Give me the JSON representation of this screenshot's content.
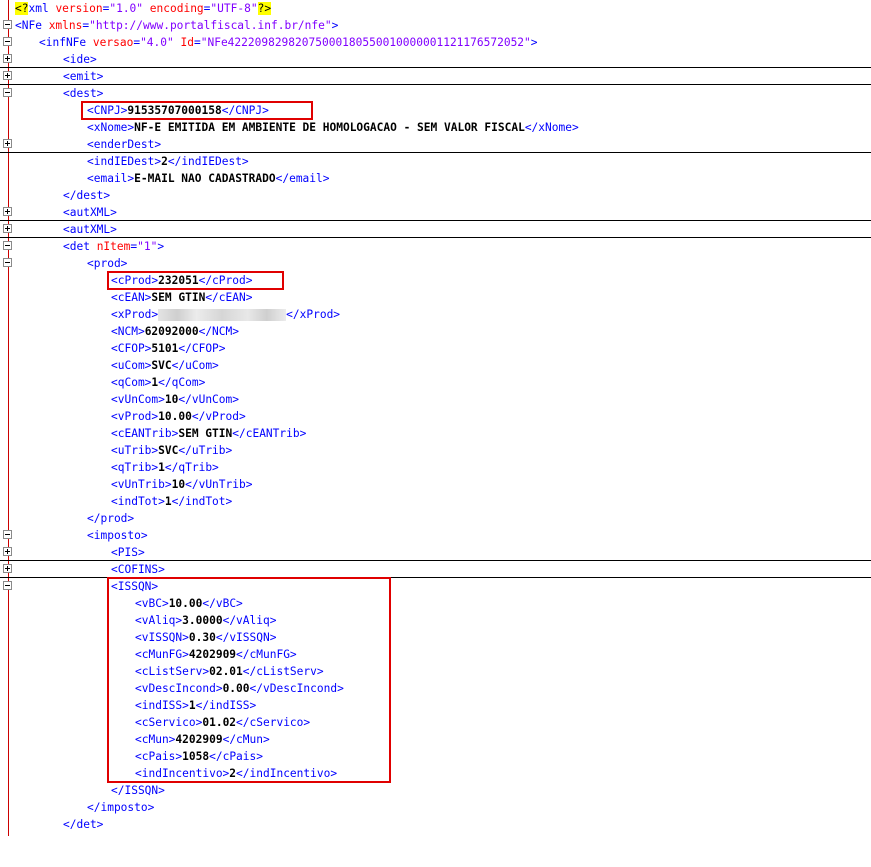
{
  "xml_decl": {
    "open": "<?",
    "name": "xml ",
    "attr1": "version",
    "val1": "\"1.0\"",
    "attr2": "encoding",
    "val2": "\"UTF-8\"",
    "close": "?>"
  },
  "nfe": {
    "tag": "<NFe ",
    "attr": "xmlns",
    "val": "\"http://www.portalfiscal.inf.br/nfe\"",
    "close": ">"
  },
  "infnfe": {
    "tag": "<infNFe ",
    "attr1": "versao",
    "val1": "\"4.0\"",
    "attr2": "Id",
    "val2": "\"NFe42220982982075000180550010000001121176572052\"",
    "close": ">"
  },
  "ide": "<ide>",
  "emit": "<emit>",
  "dest_open": "<dest>",
  "dest": {
    "cnpj_open": "<CNPJ>",
    "cnpj": "91535707000158",
    "cnpj_close": "</CNPJ>",
    "xnome_open": "<xNome>",
    "xnome": "NF-E EMITIDA EM AMBIENTE DE HOMOLOGACAO - SEM VALOR FISCAL",
    "xnome_close": "</xNome>",
    "ender": "<enderDest>",
    "indie_open": "<indIEDest>",
    "indie": "2",
    "indie_close": "</indIEDest>",
    "email_open": "<email>",
    "email": "E-MAIL NAO CADASTRADO",
    "email_close": "</email>"
  },
  "dest_close": "</dest>",
  "autxml1": "<autXML>",
  "autxml2": "<autXML>",
  "det": {
    "tag": "<det ",
    "attr": "nItem",
    "val": "\"1\"",
    "close": ">"
  },
  "prod_open": "<prod>",
  "prod": {
    "cprod_open": "<cProd>",
    "cprod": "232051",
    "cprod_close": "</cProd>",
    "cean_open": "<cEAN>",
    "cean": "SEM GTIN",
    "cean_close": "</cEAN>",
    "xprod_open": "<xProd>",
    "xprod_close": "</xProd>",
    "ncm_open": "<NCM>",
    "ncm": "62092000",
    "ncm_close": "</NCM>",
    "cfop_open": "<CFOP>",
    "cfop": "5101",
    "cfop_close": "</CFOP>",
    "ucom_open": "<uCom>",
    "ucom": "SVC",
    "ucom_close": "</uCom>",
    "qcom_open": "<qCom>",
    "qcom": "1",
    "qcom_close": "</qCom>",
    "vuncom_open": "<vUnCom>",
    "vuncom": "10",
    "vuncom_close": "</vUnCom>",
    "vprod_open": "<vProd>",
    "vprod": "10.00",
    "vprod_close": "</vProd>",
    "ceantrib_open": "<cEANTrib>",
    "ceantrib": "SEM GTIN",
    "ceantrib_close": "</cEANTrib>",
    "utrib_open": "<uTrib>",
    "utrib": "SVC",
    "utrib_close": "</uTrib>",
    "qtrib_open": "<qTrib>",
    "qtrib": "1",
    "qtrib_close": "</qTrib>",
    "vuntrib_open": "<vUnTrib>",
    "vuntrib": "10",
    "vuntrib_close": "</vUnTrib>",
    "indtot_open": "<indTot>",
    "indtot": "1",
    "indtot_close": "</indTot>"
  },
  "prod_close": "</prod>",
  "imposto_open": "<imposto>",
  "pis": "<PIS>",
  "cofins": "<COFINS>",
  "issqn_open": "<ISSQN>",
  "issqn": {
    "vbc_open": "<vBC>",
    "vbc": "10.00",
    "vbc_close": "</vBC>",
    "valiq_open": "<vAliq>",
    "valiq": "3.0000",
    "valiq_close": "</vAliq>",
    "vissqn_open": "<vISSQN>",
    "vissqn": "0.30",
    "vissqn_close": "</vISSQN>",
    "cmunfg_open": "<cMunFG>",
    "cmunfg": "4202909",
    "cmunfg_close": "</cMunFG>",
    "clistserv_open": "<cListServ>",
    "clistserv": "02.01",
    "clistserv_close": "</cListServ>",
    "vdesc_open": "<vDescIncond>",
    "vdesc": "0.00",
    "vdesc_close": "</vDescIncond>",
    "indiss_open": "<indISS>",
    "indiss": "1",
    "indiss_close": "</indISS>",
    "cservico_open": "<cServico>",
    "cservico": "01.02",
    "cservico_close": "</cServico>",
    "cmun_open": "<cMun>",
    "cmun": "4202909",
    "cmun_close": "</cMun>",
    "cpais_open": "<cPais>",
    "cpais": "1058",
    "cpais_close": "</cPais>",
    "indinc_open": "<indIncentivo>",
    "indinc": "2",
    "indinc_close": "</indIncentivo>"
  },
  "issqn_close": "</ISSQN>",
  "imposto_close": "</imposto>",
  "det_close": "</det>",
  "colors": {
    "tag": "#0000ff",
    "attr": "#ff0000",
    "value": "#8000ff",
    "highlight_box": "#e00000",
    "pi_highlight": "#ffff00"
  }
}
